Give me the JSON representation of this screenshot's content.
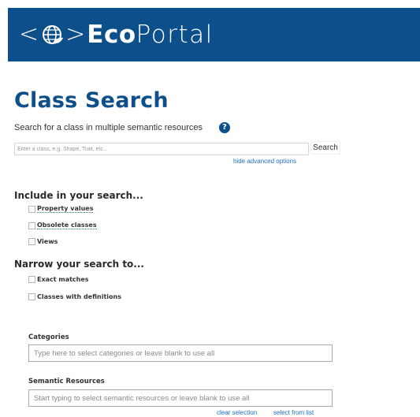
{
  "header": {
    "logo_open": "<",
    "logo_close": ">",
    "logo_bold": "Eco",
    "logo_light": "Portal"
  },
  "page": {
    "title": "Class Search",
    "subtitle": "Search for a class in multiple semantic resources",
    "help_icon_label": "?"
  },
  "search": {
    "placeholder": "Enter a class, e.g. Shape, Trait, etc...",
    "button_label": "Search",
    "hide_advanced": "hide advanced options"
  },
  "include": {
    "heading": "Include in your search...",
    "options": [
      "Property values",
      "Obsolete classes",
      "Views"
    ]
  },
  "narrow": {
    "heading": "Narrow your search to...",
    "options": [
      "Exact matches",
      "Classes with definitions"
    ]
  },
  "categories": {
    "label": "Categories",
    "placeholder": "Type here to select categories or leave blank to use all"
  },
  "resources": {
    "label": "Semantic Resources",
    "placeholder": "Start typing to select semantic resources or leave blank to use all",
    "clear_selection": "clear selection",
    "select_from_list": "select from list"
  },
  "colors": {
    "brand": "#0d4f8b",
    "link": "#1f6fc5"
  },
  "icons": [
    "globe-leaf-icon",
    "help-icon"
  ]
}
